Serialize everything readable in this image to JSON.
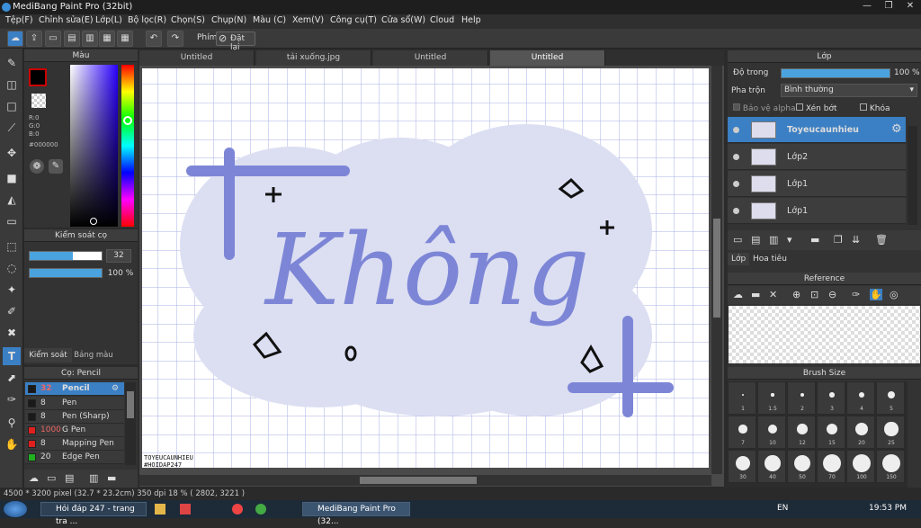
{
  "window": {
    "title": "MediBang Paint Pro (32bit)",
    "min": "—",
    "max": "❐",
    "close": "✕"
  },
  "menu": [
    "Tệp(F)",
    "Chỉnh sửa(E)",
    "Lớp(L)",
    "Bộ lọc(R)",
    "Chọn(S)",
    "Chụp(N)",
    "Màu (C)",
    "Xem(V)",
    "Công cụ(T)",
    "Cửa sổ(W)",
    "Cloud",
    "Help"
  ],
  "toolbar": {
    "phim_label": "Phím",
    "reset_label": "Đặt lại"
  },
  "color_panel": {
    "title": "Màu",
    "r": "R:0",
    "g": "G:0",
    "b": "B:0",
    "hex": "#000000"
  },
  "brush_control": {
    "title": "Kiểm soát cọ",
    "size_value": "32",
    "opacity_value": "100 %",
    "size_fill": 0.6,
    "opacity_fill": 1.0,
    "tab1": "Kiểm soát cọ",
    "tab2": "Bảng màu"
  },
  "brush_list": {
    "title": "Cọ: Pencil",
    "items": [
      {
        "size": "32",
        "name": "Pencil",
        "color": "#1a1a1a",
        "selected": true
      },
      {
        "size": "8",
        "name": "Pen",
        "color": "#1a1a1a"
      },
      {
        "size": "8",
        "name": "Pen (Sharp)",
        "color": "#1a1a1a"
      },
      {
        "size": "1000",
        "name": "G Pen",
        "color": "#e02020"
      },
      {
        "size": "8",
        "name": "Mapping Pen",
        "color": "#e02020"
      },
      {
        "size": "20",
        "name": "Edge Pen",
        "color": "#20b020"
      }
    ]
  },
  "tabs": [
    "Untitled",
    "tải xuống.jpg",
    "Untitled",
    "Untitled"
  ],
  "canvas": {
    "main_text": "Không",
    "signature_line1": "TOYEUCAUNHIEU",
    "signature_line2": "#HOIDAP247"
  },
  "layer_panel": {
    "title": "Lớp",
    "opacity_label": "Độ trong",
    "opacity_value": "100 %",
    "opacity_fill": 1.0,
    "blend_label": "Pha trộn",
    "blend_value": "Bình thường",
    "protect_alpha": "Bảo vệ alpha",
    "clip": "Xén bớt",
    "lock": "Khóa",
    "layers": [
      {
        "name": "Toyeucaunhieu",
        "selected": true
      },
      {
        "name": "Lớp2"
      },
      {
        "name": "Lớp1"
      },
      {
        "name": "Lớp1"
      }
    ],
    "tab_layer": "Lớp",
    "tab_title": "Hoa tiêu"
  },
  "reference": {
    "title": "Reference"
  },
  "brush_size": {
    "title": "Brush Size",
    "sizes": [
      "1",
      "1.5",
      "2",
      "3",
      "4",
      "5",
      "7",
      "10",
      "12",
      "15",
      "20",
      "25",
      "30",
      "40",
      "50",
      "70",
      "100",
      "150"
    ]
  },
  "status": {
    "text": "4500 * 3200 pixel   (32.7 * 23.2cm)   350 dpi   18 %   ( 2802, 3221 )"
  },
  "taskbar": {
    "task1": "Hỏi đáp 247 - trang tra ...",
    "task2": "MediBang Paint Pro (32...",
    "lang": "EN",
    "time": "19:53 PM"
  }
}
